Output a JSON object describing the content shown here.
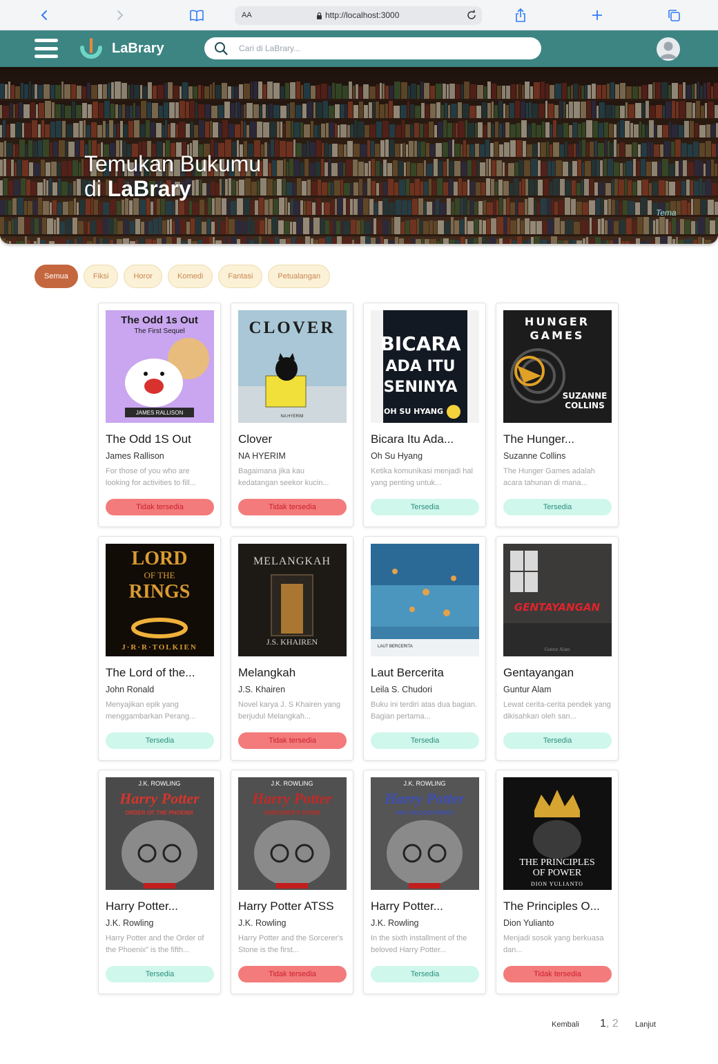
{
  "browser": {
    "url": "http://localhost:3000",
    "text_size_label": "AA"
  },
  "header": {
    "app_name": "LaBrary",
    "search_placeholder": "Cari di LaBrary..."
  },
  "hero": {
    "title_line1": "Temukan Bukumu",
    "title_line2_prefix": "di ",
    "title_line2_brand": "LaBrary",
    "image_tag": "Tema"
  },
  "categories": [
    "Semua",
    "Fiksi",
    "Horor",
    "Komedi",
    "Fantasi",
    "Petualangan"
  ],
  "active_category": "Semua",
  "books": [
    {
      "title": "The Odd 1S Out",
      "author": "James Rallison",
      "description": "For those of you who are looking for activities to fill...",
      "status": "Tidak tersedia",
      "available": false
    },
    {
      "title": "Clover",
      "author": "NA HYERIM",
      "description": "Bagaimana jika kau kedatangan seekor kucin...",
      "status": "Tidak tersedia",
      "available": false
    },
    {
      "title": "Bicara Itu Ada...",
      "author": "Oh Su Hyang",
      "description": "Ketika komunikasi menjadi hal yang penting untuk...",
      "status": "Tersedia",
      "available": true
    },
    {
      "title": "The Hunger...",
      "author": "Suzanne Collins",
      "description": "The Hunger Games adalah acara tahunan di mana...",
      "status": "Tersedia",
      "available": true
    },
    {
      "title": "The Lord of the...",
      "author": "John Ronald",
      "description": "Menyajikan epik yang menggambarkan Perang...",
      "status": "Tersedia",
      "available": true
    },
    {
      "title": "Melangkah",
      "author": "J.S. Khairen",
      "description": "Novel karya J. S Khairen yang berjudul Melangkah...",
      "status": "Tidak tersedia",
      "available": false
    },
    {
      "title": "Laut Bercerita",
      "author": "Leila S. Chudori",
      "description": "Buku ini terdiri atas dua bagian. Bagian pertama...",
      "status": "Tersedia",
      "available": true
    },
    {
      "title": "Gentayangan",
      "author": "Guntur Alam",
      "description": "Lewat cerita-cerita pendek yang dikisahkan oleh san...",
      "status": "Tersedia",
      "available": true
    },
    {
      "title": "Harry Potter...",
      "author": "J.K. Rowling",
      "description": "Harry Potter and the Order of the Phoenix\" is the fifth...",
      "status": "Tersedia",
      "available": true
    },
    {
      "title": "Harry Potter ATSS",
      "author": "J.K. Rowling",
      "description": "Harry Potter and the Sorcerer's Stone is the first...",
      "status": "Tidak tersedia",
      "available": false
    },
    {
      "title": "Harry Potter...",
      "author": "J.K. Rowling",
      "description": "In the sixth installment of the beloved Harry Potter...",
      "status": "Tersedia",
      "available": true
    },
    {
      "title": "The Principles O...",
      "author": "Dion Yulianto",
      "description": "Menjadi sosok yang berkuasa dan...",
      "status": "Tidak tersedia",
      "available": false
    }
  ],
  "covers": [
    {
      "name": "odd1sout-cover",
      "bg": "#c9a6ef",
      "text1": "The Odd 1s Out",
      "text2": "The First Sequel",
      "footer": "JAMES RALLISON",
      "fg": "#1b1b1b",
      "accent": "#f5c64b"
    },
    {
      "name": "clover-cover",
      "bg": "#a9c7d6",
      "text1": "CLOVER",
      "text2": "",
      "footer": "NA HYERIM",
      "fg": "#1d1d1d",
      "accent": "#f1df3a"
    },
    {
      "name": "bicara-cover",
      "bg": "#121922",
      "text1": "BICARA",
      "text2": "ADA ITU SENINYA",
      "footer": "OH SU HYANG",
      "fg": "#ffffff",
      "accent": "#f4d33b"
    },
    {
      "name": "hunger-games-cover",
      "bg": "#1d1c1c",
      "text1": "THE HUNGER GAMES",
      "text2": "SUZANNE COLLINS",
      "footer": "",
      "fg": "#ffffff",
      "accent": "#e0a126"
    },
    {
      "name": "lotr-cover",
      "bg": "#120c07",
      "text1": "THE LORD OF THE RINGS",
      "text2": "",
      "footer": "J·R·R·TOLKIEN",
      "fg": "#d99c32",
      "accent": "#f0b13b"
    },
    {
      "name": "melangkah-cover",
      "bg": "#1d1a16",
      "text1": "MELANGKAH",
      "text2": "",
      "footer": "J.S. KHAIREN",
      "fg": "#d2d2d2",
      "accent": "#e09a3a"
    },
    {
      "name": "laut-bercerita-cover",
      "bg": "#3c7fa8",
      "text1": "",
      "text2": "",
      "footer": "LAUT BERCERITA",
      "fg": "#ffffff",
      "accent": "#e6a14a"
    },
    {
      "name": "gentayangan-cover",
      "bg": "#3b3a39",
      "text1": "GENTAYANGAN",
      "text2": "",
      "footer": "Guntur Alam",
      "fg": "#e0232b",
      "accent": "#8b8b8b"
    },
    {
      "name": "hp-phoenix-cover",
      "bg": "#4a4a4a",
      "text1": "Harry Potter",
      "text2": "ORDER OF THE PHOENIX",
      "footer": "J.K. ROWLING",
      "fg": "#d6352b",
      "accent": "#c21e1e"
    },
    {
      "name": "hp-stone-cover",
      "bg": "#505050",
      "text1": "Harry Potter",
      "text2": "SORCERER'S STONE",
      "footer": "J.K. ROWLING",
      "fg": "#c22a25",
      "accent": "#c21e1e"
    },
    {
      "name": "hp-prince-cover",
      "bg": "#555555",
      "text1": "Harry Potter",
      "text2": "HALF-BLOOD PRINCE",
      "footer": "J.K. ROWLING",
      "fg": "#3c4fb8",
      "accent": "#c21e1e"
    },
    {
      "name": "principles-cover",
      "bg": "#101010",
      "text1": "THE PRINCIPLES",
      "text2": "OF POWER",
      "footer": "DION YULIANTO",
      "fg": "#ffffff",
      "accent": "#d6a431"
    }
  ],
  "pagination": {
    "prev_label": "Kembali",
    "current_page": "1",
    "separator": ",",
    "next_page": "2",
    "next_label": "Lanjut"
  },
  "colors": {
    "header": "#3c8583",
    "chip_active": "#c4673f",
    "chip_bg": "#fbf1d6",
    "status_available": "#cff7ec",
    "status_unavailable": "#f37b7b"
  }
}
